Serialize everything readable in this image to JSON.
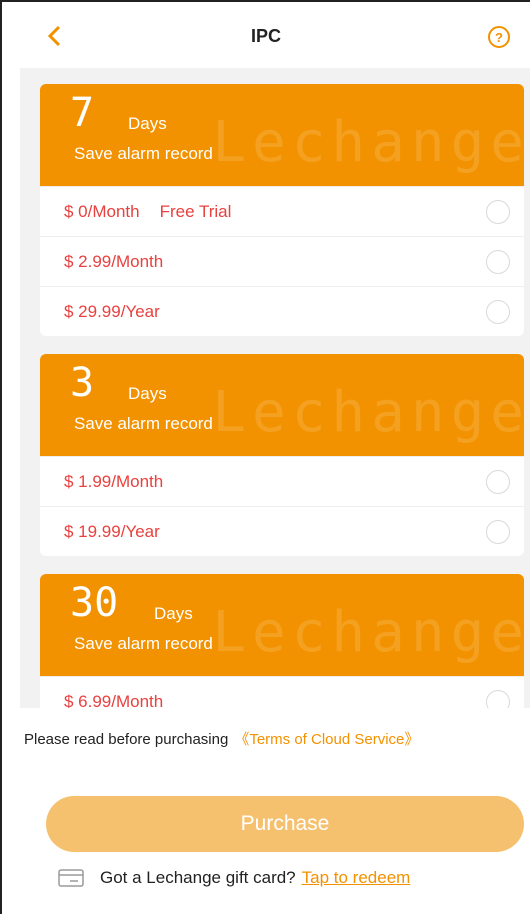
{
  "header": {
    "title": "IPC",
    "back_icon": "chevron-left-icon",
    "help_icon": "question-circle-icon",
    "help_glyph": "?"
  },
  "plans": [
    {
      "days": "7",
      "days_label": "Days",
      "subtitle": "Save alarm record",
      "watermark": "Lechange",
      "options": [
        {
          "price": "$ 0/Month",
          "tag": "Free Trial"
        },
        {
          "price": "$ 2.99/Month"
        },
        {
          "price": "$ 29.99/Year"
        }
      ]
    },
    {
      "days": "3",
      "days_label": "Days",
      "subtitle": "Save alarm record",
      "watermark": "Lechange",
      "options": [
        {
          "price": "$ 1.99/Month"
        },
        {
          "price": "$ 19.99/Year"
        }
      ]
    },
    {
      "days": "30",
      "days_label": "Days",
      "subtitle": "Save alarm record",
      "watermark": "Lechange",
      "options": [
        {
          "price": "$ 6.99/Month"
        }
      ]
    }
  ],
  "footer": {
    "terms_prefix": "Please read before purchasing",
    "terms_link": "《Terms of Cloud Service》",
    "purchase_label": "Purchase",
    "gift_text": "Got a Lechange gift card?",
    "redeem_link": "Tap to redeem",
    "gift_icon": "card-icon"
  },
  "colors": {
    "accent": "#f39200",
    "price": "#e8413f",
    "purchase_disabled": "#f6c16f",
    "background": "#f2f2f2"
  }
}
